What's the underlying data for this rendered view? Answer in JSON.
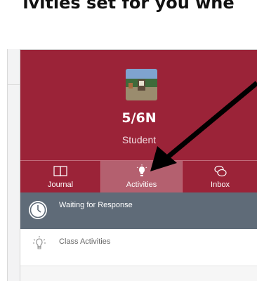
{
  "caption": "ivities set for you whe",
  "profile": {
    "avatar_icon": "class-photo",
    "class_name": "5/6N",
    "role": "Student",
    "brand_color": "#9b2338"
  },
  "nav": {
    "items": [
      {
        "label": "Journal",
        "icon": "book-icon"
      },
      {
        "label": "Activities",
        "icon": "lightbulb-icon",
        "active": true
      },
      {
        "label": "Inbox",
        "icon": "chat-bubbles-icon"
      }
    ]
  },
  "feed": {
    "waiting_label": "Waiting for Response",
    "waiting_icon": "clock-icon",
    "class_activities_label": "Class Activities",
    "class_activities_icon": "lightbulb-icon"
  },
  "annotation": {
    "arrow_icon": "black-arrow"
  }
}
